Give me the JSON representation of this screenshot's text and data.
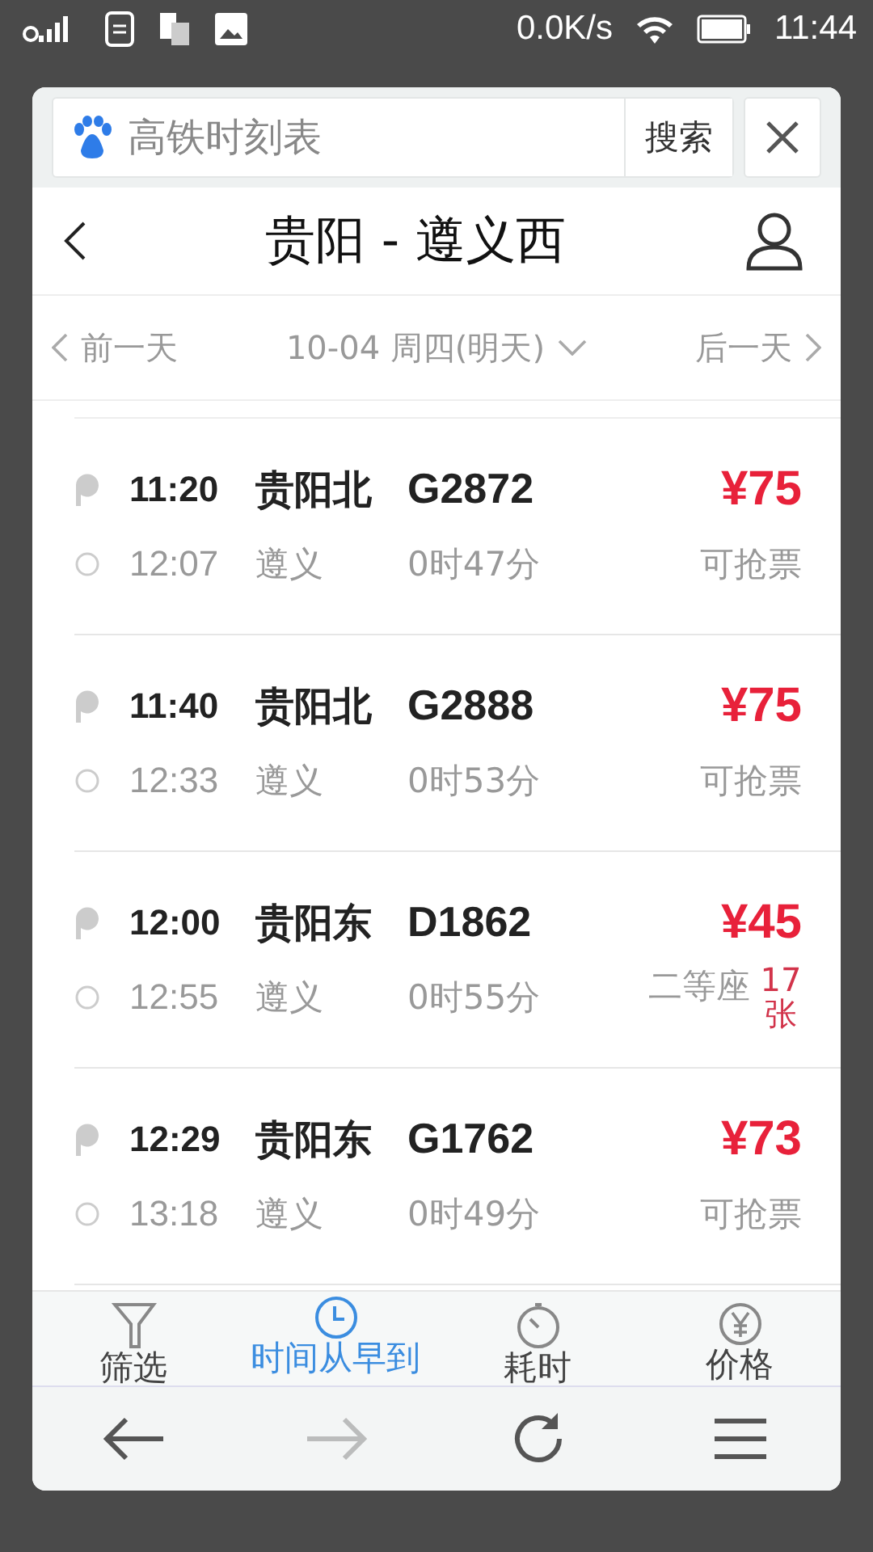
{
  "status_bar": {
    "speed": "0.0K/s",
    "time": "11:44"
  },
  "search": {
    "value": "高铁时刻表",
    "button": "搜索"
  },
  "header": {
    "title": "贵阳 - 遵义西"
  },
  "date_bar": {
    "prev": "前一天",
    "current": "10-04 周四(明天)",
    "next": "后一天"
  },
  "trains": [
    {
      "depart_time": "11:20",
      "depart_station": "贵阳北",
      "train_no": "G2872",
      "price": "¥75",
      "arrive_time": "12:07",
      "arrive_station": "遵义",
      "duration": "0时47分",
      "kind": "status",
      "status": "可抢票"
    },
    {
      "depart_time": "11:40",
      "depart_station": "贵阳北",
      "train_no": "G2888",
      "price": "¥75",
      "arrive_time": "12:33",
      "arrive_station": "遵义",
      "duration": "0时53分",
      "kind": "status",
      "status": "可抢票"
    },
    {
      "depart_time": "12:00",
      "depart_station": "贵阳东",
      "train_no": "D1862",
      "price": "¥45",
      "arrive_time": "12:55",
      "arrive_station": "遵义",
      "duration": "0时55分",
      "kind": "seats",
      "seat_class": "二等座",
      "seats": "17张"
    },
    {
      "depart_time": "12:29",
      "depart_station": "贵阳东",
      "train_no": "G1762",
      "price": "¥73",
      "arrive_time": "13:18",
      "arrive_station": "遵义",
      "duration": "0时49分",
      "kind": "status",
      "status": "可抢票"
    }
  ],
  "sort_bar": [
    {
      "kind": "filter",
      "label": "筛选",
      "selected": false
    },
    {
      "kind": "time",
      "label": "时间从早到",
      "selected": true
    },
    {
      "kind": "duration",
      "label": "耗时",
      "selected": false
    },
    {
      "kind": "price",
      "label": "价格",
      "selected": false
    }
  ],
  "nav": [
    {
      "kind": "back",
      "disabled": false
    },
    {
      "kind": "forward",
      "disabled": true
    },
    {
      "kind": "refresh",
      "disabled": false
    },
    {
      "kind": "menu",
      "disabled": false
    }
  ]
}
